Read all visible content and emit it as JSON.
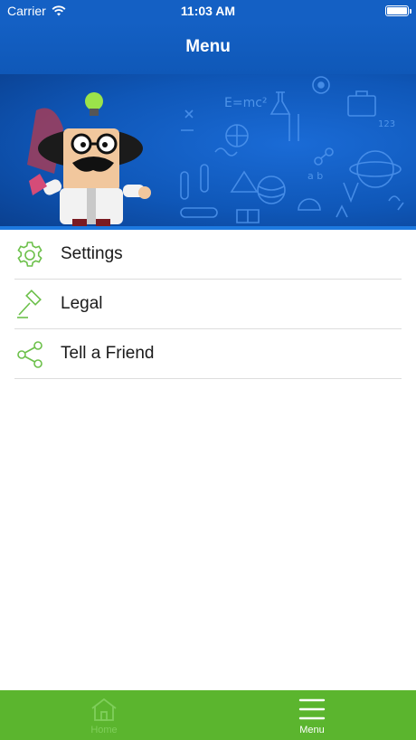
{
  "status_bar": {
    "carrier": "Carrier",
    "time": "11:03 AM",
    "wifi_icon": "wifi-icon",
    "battery_icon": "battery-icon"
  },
  "nav": {
    "title": "Menu"
  },
  "banner": {
    "illustration": "scientist-illustration",
    "formula": "E=mc²"
  },
  "menu": {
    "items": [
      {
        "label": "Settings",
        "icon": "gear-icon"
      },
      {
        "label": "Legal",
        "icon": "gavel-icon"
      },
      {
        "label": "Tell a Friend",
        "icon": "share-icon"
      }
    ]
  },
  "tab_bar": {
    "tabs": [
      {
        "label": "Home",
        "icon": "home-icon",
        "selected": false
      },
      {
        "label": "Menu",
        "icon": "hamburger-icon",
        "selected": true
      }
    ]
  },
  "colors": {
    "brand_blue": "#1460c4",
    "accent_green": "#5bb52e",
    "icon_green": "#6cc04a"
  }
}
